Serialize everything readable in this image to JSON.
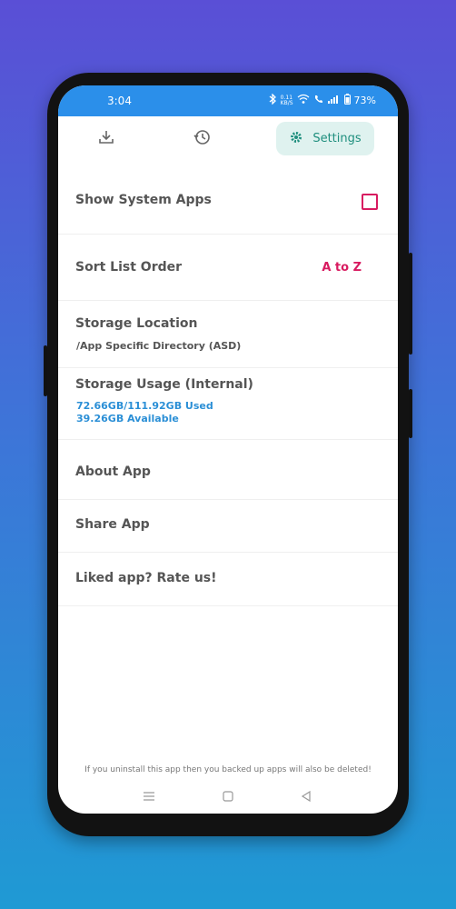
{
  "status": {
    "time": "3:04",
    "network_speed": "0.11\nKB/S",
    "battery": "73%"
  },
  "toolbar": {
    "settings_label": "Settings"
  },
  "settings": {
    "show_system_apps": "Show System Apps",
    "sort_list_order": "Sort List Order",
    "sort_value": "A to Z",
    "storage_location": "Storage Location",
    "storage_location_value": "/App Specific Directory (ASD)",
    "storage_usage": "Storage Usage (Internal)",
    "storage_used": "72.66GB/111.92GB Used",
    "storage_available": "39.26GB Available",
    "about_app": "About App",
    "share_app": "Share App",
    "rate_app": "Liked app? Rate us!"
  },
  "footer": {
    "note": "If you uninstall this app then you backed up apps will also be deleted!"
  }
}
